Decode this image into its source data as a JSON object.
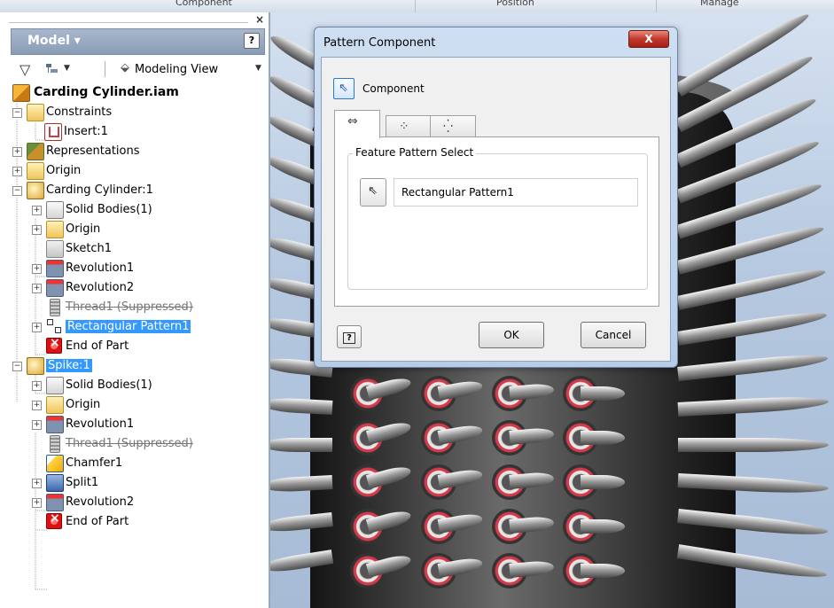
{
  "ribbon": {
    "labels": [
      "Component",
      "Position",
      "Manage"
    ]
  },
  "browser": {
    "title": "Model",
    "close_glyph": "×",
    "help_glyph": "?",
    "view_label": "Modeling View",
    "tree": [
      {
        "label": "Carding Cylinder.iam",
        "icon": "assembly-icon"
      },
      {
        "label": "Constraints",
        "icon": "folder-icon"
      },
      {
        "label": "Insert:1",
        "icon": "insert-constraint-icon"
      },
      {
        "label": "Representations",
        "icon": "representations-icon"
      },
      {
        "label": "Origin",
        "icon": "folder-icon"
      },
      {
        "label": "Carding Cylinder:1",
        "icon": "part-icon"
      },
      {
        "label": "Solid Bodies(1)",
        "icon": "solid-bodies-icon"
      },
      {
        "label": "Origin",
        "icon": "folder-icon"
      },
      {
        "label": "Sketch1",
        "icon": "sketch-icon"
      },
      {
        "label": "Revolution1",
        "icon": "revolve-icon"
      },
      {
        "label": "Revolution2",
        "icon": "revolve-icon"
      },
      {
        "label": "Thread1 (Suppressed)",
        "icon": "thread-icon",
        "suppressed": true
      },
      {
        "label": "Rectangular Pattern1",
        "icon": "rectangular-pattern-icon",
        "selected": true
      },
      {
        "label": "End of Part",
        "icon": "end-of-part-icon"
      },
      {
        "label": "Spike:1",
        "icon": "part-icon",
        "selected": true
      },
      {
        "label": "Solid Bodies(1)",
        "icon": "solid-bodies-icon"
      },
      {
        "label": "Origin",
        "icon": "folder-icon"
      },
      {
        "label": "Revolution1",
        "icon": "revolve-icon"
      },
      {
        "label": "Thread1 (Suppressed)",
        "icon": "thread-icon",
        "suppressed": true
      },
      {
        "label": "Chamfer1",
        "icon": "chamfer-icon"
      },
      {
        "label": "Split1",
        "icon": "split-icon"
      },
      {
        "label": "Revolution2",
        "icon": "revolve-icon"
      },
      {
        "label": "End of Part",
        "icon": "end-of-part-icon"
      }
    ]
  },
  "dialog": {
    "title": "Pattern Component",
    "close_glyph": "X",
    "component_label": "Component",
    "tabs": [
      {
        "icon": "associative-pattern-icon",
        "active": true
      },
      {
        "icon": "rectangular-pattern-icon",
        "active": false
      },
      {
        "icon": "circular-pattern-icon",
        "active": false
      }
    ],
    "group_title": "Feature Pattern Select",
    "feature_value": "Rectangular Pattern1",
    "help_glyph": "?",
    "ok_label": "OK",
    "cancel_label": "Cancel"
  },
  "colors": {
    "selection": "#3399ff",
    "dialog_close": "#c2382a",
    "hole_ring": "#d43a4a"
  }
}
